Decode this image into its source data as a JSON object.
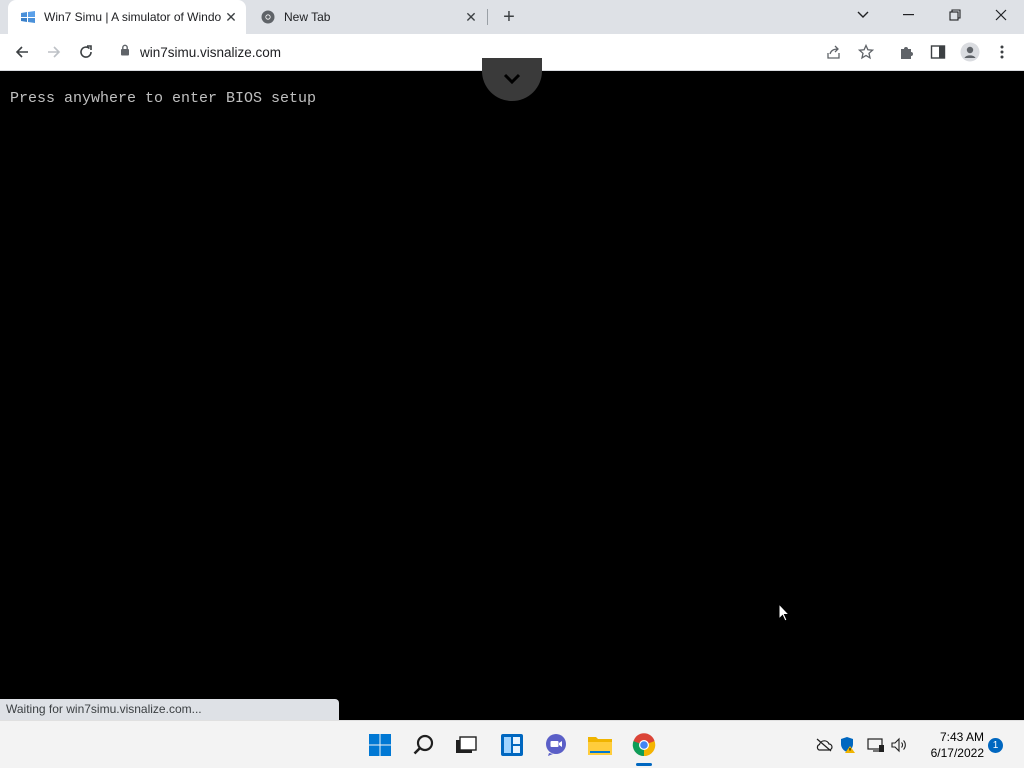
{
  "browser": {
    "tabs": [
      {
        "title": "Win7 Simu | A simulator of Windo",
        "active": true
      },
      {
        "title": "New Tab",
        "active": false
      }
    ],
    "new_tab_label": "+",
    "url": "win7simu.visnalize.com",
    "window_controls": [
      "chevron-down-icon",
      "minimize-icon",
      "restore-icon",
      "close-icon"
    ]
  },
  "page": {
    "bios_message": "Press anywhere to enter BIOS setup",
    "status": "Waiting for win7simu.visnalize.com..."
  },
  "taskbar": {
    "apps": [
      "start-icon",
      "search-icon",
      "task-view-icon",
      "widgets-icon",
      "chat-icon",
      "file-explorer-icon",
      "chrome-icon"
    ],
    "clock_time": "7:43 AM",
    "clock_date": "6/17/2022",
    "notification_count": "1"
  },
  "colors": {
    "tabstrip": "#dee1e6",
    "accent": "#0067c0",
    "bios_text": "#c0c0c0"
  }
}
